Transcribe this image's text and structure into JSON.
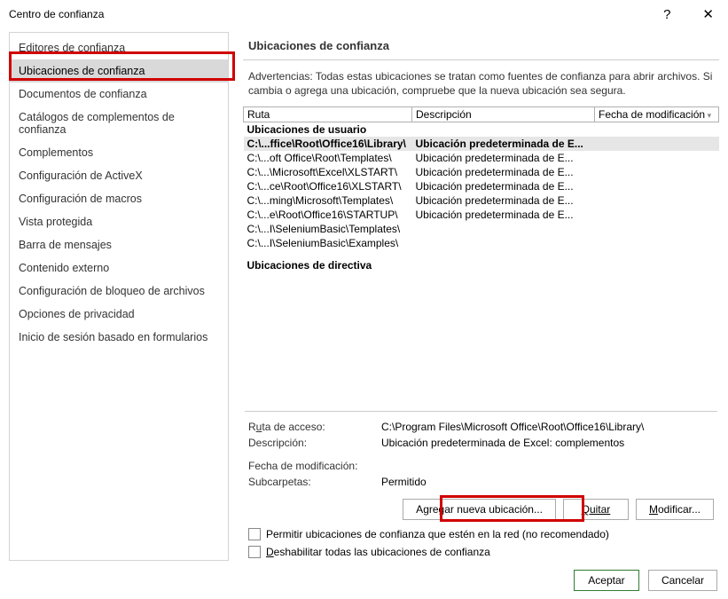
{
  "title": "Centro de confianza",
  "sidebar": {
    "items": [
      {
        "label": "Editores de confianza"
      },
      {
        "label": "Ubicaciones de confianza"
      },
      {
        "label": "Documentos de confianza"
      },
      {
        "label": "Catálogos de complementos de confianza"
      },
      {
        "label": "Complementos"
      },
      {
        "label": "Configuración de ActiveX"
      },
      {
        "label": "Configuración de macros"
      },
      {
        "label": "Vista protegida"
      },
      {
        "label": "Barra de mensajes"
      },
      {
        "label": "Contenido externo"
      },
      {
        "label": "Configuración de bloqueo de archivos"
      },
      {
        "label": "Opciones de privacidad"
      },
      {
        "label": "Inicio de sesión basado en formularios"
      }
    ],
    "selected_index": 1
  },
  "main": {
    "header": "Ubicaciones de confianza",
    "warning": "Advertencias: Todas estas ubicaciones se tratan como fuentes de confianza para abrir archivos. Si cambia o agrega una ubicación, compruebe que la nueva ubicación sea segura.",
    "columns": {
      "path": "Ruta",
      "desc": "Descripción",
      "date": "Fecha de modificación"
    },
    "group_user": "Ubicaciones de usuario",
    "group_policy": "Ubicaciones de directiva",
    "rows": [
      {
        "path": "C:\\...ffice\\Root\\Office16\\Library\\",
        "desc": "Ubicación predeterminada de E..."
      },
      {
        "path": "C:\\...oft Office\\Root\\Templates\\",
        "desc": "Ubicación predeterminada de E..."
      },
      {
        "path": "C:\\...\\Microsoft\\Excel\\XLSTART\\",
        "desc": "Ubicación predeterminada de E..."
      },
      {
        "path": "C:\\...ce\\Root\\Office16\\XLSTART\\",
        "desc": "Ubicación predeterminada de E..."
      },
      {
        "path": "C:\\...ming\\Microsoft\\Templates\\",
        "desc": "Ubicación predeterminada de E..."
      },
      {
        "path": "C:\\...e\\Root\\Office16\\STARTUP\\",
        "desc": "Ubicación predeterminada de E..."
      },
      {
        "path": "C:\\...I\\SeleniumBasic\\Templates\\",
        "desc": ""
      },
      {
        "path": "C:\\...I\\SeleniumBasic\\Examples\\",
        "desc": ""
      }
    ],
    "details": {
      "path_label_pre": "R",
      "path_label_u": "u",
      "path_label_post": "ta de acceso:",
      "path_value": "C:\\Program Files\\Microsoft Office\\Root\\Office16\\Library\\",
      "desc_label": "Descripción:",
      "desc_value": "Ubicación predeterminada de Excel: complementos",
      "date_label": "Fecha de modificación:",
      "date_value": "",
      "sub_label": "Subcarpetas:",
      "sub_value": "Permitido"
    },
    "buttons": {
      "add_pre": "A",
      "add_u": "g",
      "add_post": "regar nueva ubicación...",
      "remove": "Quitar",
      "modify_u": "M",
      "modify_post": "odificar..."
    },
    "checks": {
      "network_pre": "Permitir ubicaciones de confianza que estén en la red (no recomendado)",
      "disable_u": "D",
      "disable_post": "eshabilitar todas las ubicaciones de confianza"
    }
  },
  "footer": {
    "ok": "Aceptar",
    "cancel": "Cancelar"
  }
}
